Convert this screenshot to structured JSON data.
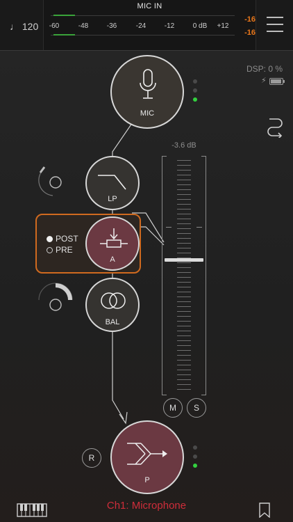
{
  "header": {
    "tempo": "♩ 120",
    "meter_title": "MIC IN",
    "scale_labels": [
      "-60",
      "-48",
      "-36",
      "-24",
      "-12",
      "0 dB",
      "+12"
    ],
    "peak_top": "-16",
    "peak_bottom": "-16",
    "level_fraction": 0.12,
    "menu_icon": "hamburger-menu-icon"
  },
  "status": {
    "dsp": "DSP:  0 %",
    "battery_icon": "battery-charging-icon",
    "route_icon": "routing-icon"
  },
  "nodes": {
    "mic": {
      "label": "MIC",
      "icon": "microphone-icon"
    },
    "lp": {
      "label": "LP",
      "icon": "lowpass-filter-icon"
    },
    "a": {
      "label": "A",
      "icon": "attenuator-icon"
    },
    "bal": {
      "label": "BAL",
      "icon": "balance-icon"
    },
    "p": {
      "label": "P",
      "icon": "mixer-sum-icon"
    }
  },
  "post_pre": {
    "post": "POST",
    "pre": "PRE",
    "selected": "POST"
  },
  "fader": {
    "value": "-3.6 dB",
    "position_fraction": 0.43,
    "mute": "M",
    "solo": "S"
  },
  "bottom": {
    "record": "R",
    "channel": "Ch1: Microphone",
    "keyboard_icon": "piano-keyboard-icon",
    "bookmark_icon": "bookmark-icon"
  },
  "colors": {
    "accent_orange": "#d06a1f",
    "channel_red": "#cf2d3a",
    "node_maroon": "#6b3942",
    "led_green": "#33d13f"
  }
}
